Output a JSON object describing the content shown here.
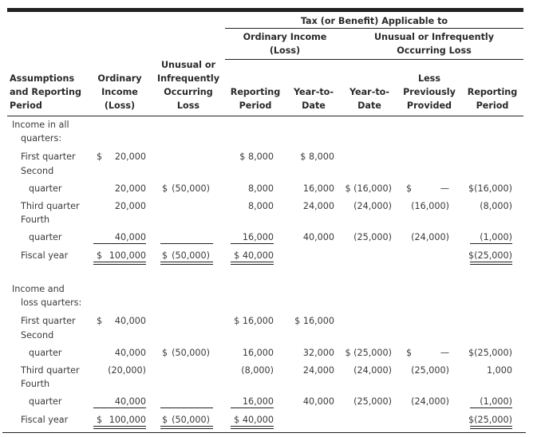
{
  "header": {
    "group_title": "Tax (or Benefit) Applicable to",
    "sub_ordinary": [
      "Ordinary Income",
      "(Loss)"
    ],
    "sub_unusual": [
      "Unusual or Infrequently",
      "Occurring Loss"
    ],
    "columns": [
      [
        "Assumptions",
        "and Reporting",
        "Period"
      ],
      [
        "Ordinary",
        "Income",
        "(Loss)"
      ],
      [
        "Unusual or",
        "Infrequently",
        "Occurring",
        "Loss"
      ],
      [
        "Reporting",
        "Period"
      ],
      [
        "Year-to-",
        "Date"
      ],
      [
        "Year-to-",
        "Date"
      ],
      [
        "Less",
        "Previously",
        "Provided"
      ],
      [
        "Reporting",
        "Period"
      ]
    ]
  },
  "sections": [
    {
      "title": [
        "Income in all",
        "quarters:"
      ],
      "rows": [
        {
          "label": [
            "First quarter"
          ],
          "c1_sign": "$",
          "c1": "20,000",
          "c2_sign": "",
          "c2": "",
          "c3": "$  8,000",
          "c4": "$  8,000",
          "c5": "",
          "c6_sign": "",
          "c6": "",
          "c7": ""
        },
        {
          "label": [
            "Second",
            "quarter"
          ],
          "c1_sign": "",
          "c1": "20,000",
          "c2_sign": "$",
          "c2": "(50,000)",
          "c3": "8,000",
          "c4": "16,000",
          "c5": "$ (16,000)",
          "c6_sign": "$",
          "c6": "—",
          "c7": "$(16,000)"
        },
        {
          "label": [
            "Third quarter"
          ],
          "c1_sign": "",
          "c1": "20,000",
          "c2_sign": "",
          "c2": "",
          "c3": "8,000",
          "c4": "24,000",
          "c5": "(24,000)",
          "c6_sign": "",
          "c6": "(16,000)",
          "c7": "(8,000)"
        },
        {
          "label": [
            "Fourth",
            "quarter"
          ],
          "c1_sign": "",
          "c1": "40,000",
          "c2_sign": "",
          "c2": "",
          "c3": "16,000",
          "c4": "40,000",
          "c5": "(25,000)",
          "c6_sign": "",
          "c6": "(24,000)",
          "c7": "(1,000)"
        },
        {
          "label": [
            "Fiscal year"
          ],
          "c1_sign": "$",
          "c1": "100,000",
          "c2_sign": "$",
          "c2": "(50,000)",
          "c3": "$ 40,000",
          "c4": "",
          "c5": "",
          "c6_sign": "",
          "c6": "",
          "c7": "$(25,000)"
        }
      ]
    },
    {
      "title": [
        "Income and",
        "loss quarters:"
      ],
      "rows": [
        {
          "label": [
            "First quarter"
          ],
          "c1_sign": "$",
          "c1": "40,000",
          "c2_sign": "",
          "c2": "",
          "c3": "$ 16,000",
          "c4": "$ 16,000",
          "c5": "",
          "c6_sign": "",
          "c6": "",
          "c7": ""
        },
        {
          "label": [
            "Second",
            "quarter"
          ],
          "c1_sign": "",
          "c1": "40,000",
          "c2_sign": "$",
          "c2": "(50,000)",
          "c3": "16,000",
          "c4": "32,000",
          "c5": "$ (25,000)",
          "c6_sign": "$",
          "c6": "—",
          "c7": "$(25,000)"
        },
        {
          "label": [
            "Third quarter"
          ],
          "c1_sign": "",
          "c1": "(20,000)",
          "c2_sign": "",
          "c2": "",
          "c3": "(8,000)",
          "c4": "24,000",
          "c5": "(24,000)",
          "c6_sign": "",
          "c6": "(25,000)",
          "c7": "1,000"
        },
        {
          "label": [
            "Fourth",
            "quarter"
          ],
          "c1_sign": "",
          "c1": "40,000",
          "c2_sign": "",
          "c2": "",
          "c3": "16,000",
          "c4": "40,000",
          "c5": "(25,000)",
          "c6_sign": "",
          "c6": "(24,000)",
          "c7": "(1,000)"
        },
        {
          "label": [
            "Fiscal year"
          ],
          "c1_sign": "$",
          "c1": "100,000",
          "c2_sign": "$",
          "c2": "(50,000)",
          "c3": "$ 40,000",
          "c4": "",
          "c5": "",
          "c6_sign": "",
          "c6": "",
          "c7": "$(25,000)"
        }
      ]
    }
  ]
}
